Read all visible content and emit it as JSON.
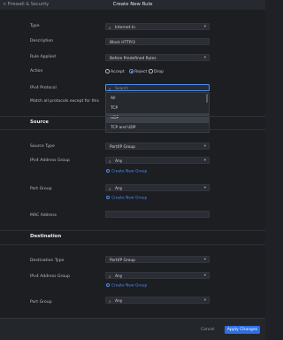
{
  "header": {
    "breadcrumb": "< Firewall & Security",
    "title": "Create New Rule"
  },
  "form": {
    "type": {
      "label": "Type",
      "value": "Internet In"
    },
    "description": {
      "label": "Description",
      "value": "Block HTTP/3"
    },
    "rule_applied": {
      "label": "Rule Applied",
      "value": "Before Predefined Rules"
    },
    "action": {
      "label": "Action",
      "options": [
        "Accept",
        "Reject",
        "Drop"
      ],
      "selected": "Reject"
    },
    "ipv4_protocol": {
      "label": "IPv4 Protocol"
    },
    "match_all": {
      "label": "Match all protocols except for this"
    }
  },
  "dropdown": {
    "search_placeholder": "Search",
    "options": [
      "All",
      "TCP",
      "UDP",
      "TCP and UDP"
    ],
    "highlighted": "UDP"
  },
  "source": {
    "section_title": "Source",
    "source_type": {
      "label": "Source Type",
      "value": "Port/IP Group"
    },
    "ipv4_group": {
      "label": "IPv4 Address Group",
      "value": "Any",
      "create_link": "Create New Group"
    },
    "port_group": {
      "label": "Port Group",
      "value": "Any",
      "create_link": "Create New Group"
    },
    "mac_address": {
      "label": "MAC Address",
      "value": ""
    }
  },
  "destination": {
    "section_title": "Destination",
    "destination_type": {
      "label": "Destination Type",
      "value": "Port/IP Group"
    },
    "ipv4_group": {
      "label": "IPv4 Address Group",
      "value": "Any",
      "create_link": "Create New Group"
    },
    "port_group": {
      "label": "Port Group",
      "value": "Any"
    }
  },
  "footer": {
    "cancel_label": "Cancel",
    "apply_label": "Apply Changes"
  },
  "colors": {
    "accent": "#2e6ee6",
    "link": "#4b8ef0",
    "background": "#1c1e22"
  },
  "icons": {
    "search": "search-icon",
    "caret": "chevron-down-icon",
    "add": "plus-circle-icon"
  }
}
